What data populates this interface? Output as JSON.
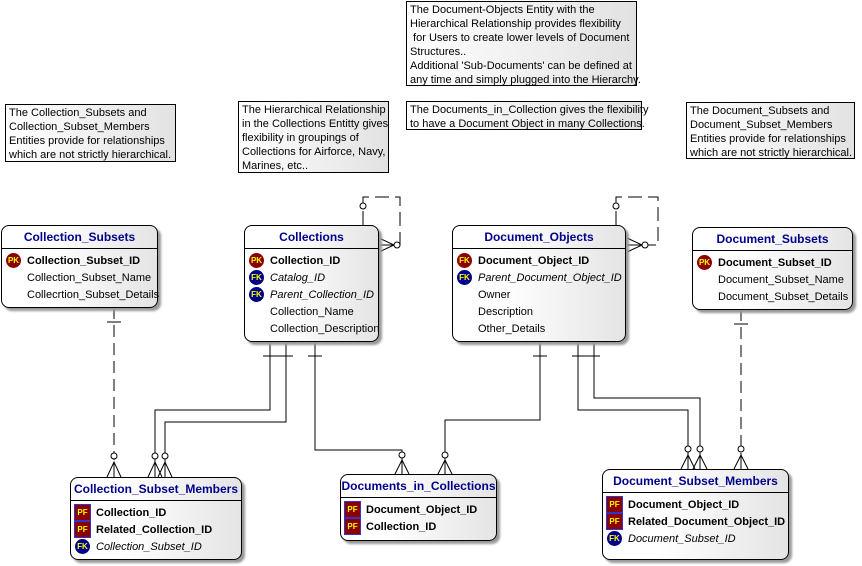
{
  "notes": [
    {
      "text": "The Collection_Subsets and\nCollection_Subset_Members\nEntities provide for relationships\nwhich are not strictly hierarchical."
    },
    {
      "text": "The Hierarchical Relationship\nin the Collections Entitty gives\nflexibility in groupings of\nCollections for Airforce, Navy,\nMarines, etc.."
    },
    {
      "text": "The Document-Objects Entity with the\nHierarchical Relationship provides flexibility\n for Users to create lower levels of Document\nStructures..\nAdditional 'Sub-Documents' can be defined at\nany time and simply plugged into the Hierarchy."
    },
    {
      "text": "The Documents_in_Collection gives the flexibility\nto have a Document Object in many Collections."
    },
    {
      "text": "The Document_Subsets and\nDocument_Subset_Members\nEntities provide for relationships\nwhich are not strictly hierarchical."
    }
  ],
  "entities": [
    {
      "name": "Collection_Subsets",
      "attributes": [
        {
          "name": "Collection_Subset_ID",
          "key": "PK",
          "style": "bold"
        },
        {
          "name": "Collection_Subset_Name",
          "key": "",
          "style": "normal"
        },
        {
          "name": "Collecrtion_Subset_Details",
          "key": "",
          "style": "normal"
        }
      ]
    },
    {
      "name": "Collections",
      "attributes": [
        {
          "name": "Collection_ID",
          "key": "PK",
          "style": "bold"
        },
        {
          "name": "Catalog_ID",
          "key": "FK",
          "style": "italic"
        },
        {
          "name": "Parent_Collection_ID",
          "key": "FK",
          "style": "italic"
        },
        {
          "name": "Collection_Name",
          "key": "",
          "style": "normal"
        },
        {
          "name": "Collection_Description",
          "key": "",
          "style": "normal"
        }
      ]
    },
    {
      "name": "Document_Objects",
      "attributes": [
        {
          "name": "Document_Object_ID",
          "key": "FK",
          "keyColor": "#8b0000",
          "style": "bold"
        },
        {
          "name": "Parent_Document_Object_ID",
          "key": "FK",
          "style": "italic"
        },
        {
          "name": "Owner",
          "key": "",
          "style": "normal"
        },
        {
          "name": "Description",
          "key": "",
          "style": "normal"
        },
        {
          "name": "Other_Details",
          "key": "",
          "style": "normal"
        }
      ]
    },
    {
      "name": "Document_Subsets",
      "attributes": [
        {
          "name": "Document_Subset_ID",
          "key": "PK",
          "style": "bold"
        },
        {
          "name": "Document_Subset_Name",
          "key": "",
          "style": "normal"
        },
        {
          "name": "Document_Subset_Details",
          "key": "",
          "style": "normal"
        }
      ]
    },
    {
      "name": "Collection_Subset_Members",
      "attributes": [
        {
          "name": "Collection_ID",
          "key": "PF",
          "style": "bold"
        },
        {
          "name": "Related_Collection_ID",
          "key": "PF",
          "style": "bold"
        },
        {
          "name": "Collection_Subset_ID",
          "key": "FK",
          "style": "italic"
        }
      ]
    },
    {
      "name": "Documents_in_Collections",
      "attributes": [
        {
          "name": "Document_Object_ID",
          "key": "PF",
          "style": "bold"
        },
        {
          "name": "Collection_ID",
          "key": "PF",
          "style": "bold"
        }
      ]
    },
    {
      "name": "Document_Subset_Members",
      "attributes": [
        {
          "name": "Document_Object_ID",
          "key": "PF",
          "style": "bold"
        },
        {
          "name": "Related_Document_Object_ID",
          "key": "PF",
          "style": "bold"
        },
        {
          "name": "Document_Subset_ID",
          "key": "FK",
          "style": "italic"
        }
      ]
    }
  ],
  "colors": {
    "entity_title": "#00008b",
    "pk_badge": "#8b0000",
    "fk_badge": "#00008b",
    "badge_text": "#ffff00"
  }
}
